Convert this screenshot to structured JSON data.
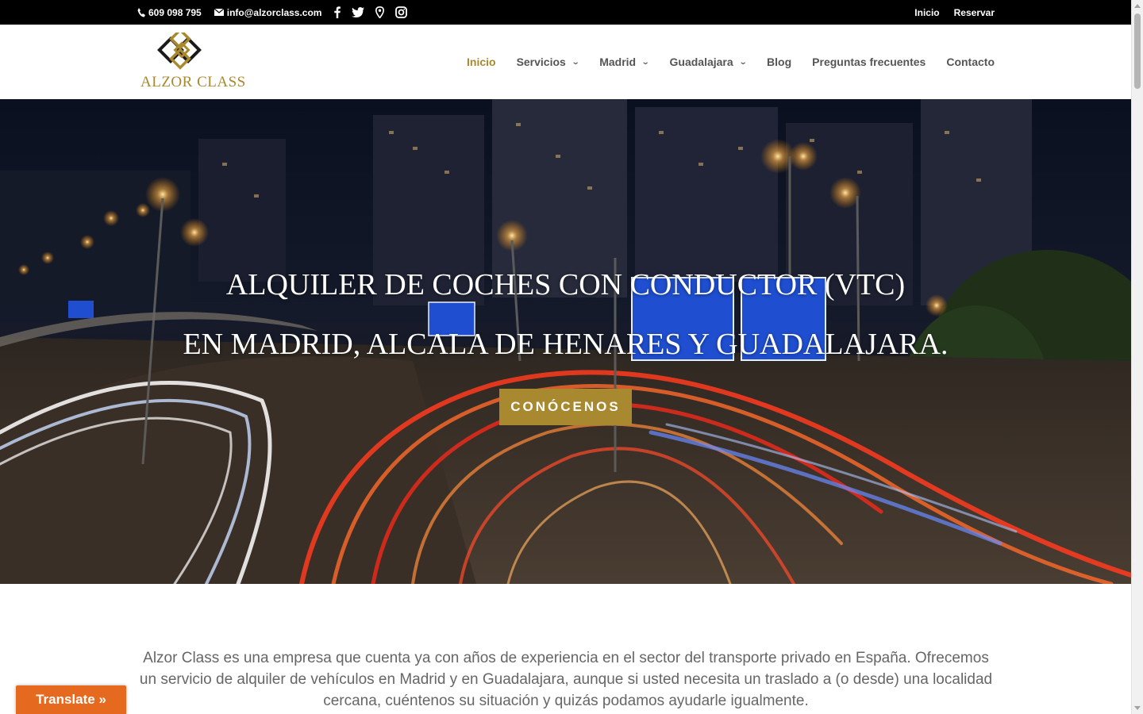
{
  "topbar": {
    "phone": "609 098 795",
    "email": "info@alzorclass.com",
    "social_icons": [
      "facebook-icon",
      "twitter-icon",
      "map-pin-icon",
      "instagram-icon"
    ],
    "links": [
      "Inicio",
      "Reservar"
    ]
  },
  "header": {
    "logo_text": "ALZOR CLASS",
    "nav": [
      {
        "label": "Inicio",
        "active": true,
        "dropdown": false
      },
      {
        "label": "Servicios",
        "active": false,
        "dropdown": true
      },
      {
        "label": "Madrid",
        "active": false,
        "dropdown": true
      },
      {
        "label": "Guadalajara",
        "active": false,
        "dropdown": true
      },
      {
        "label": "Blog",
        "active": false,
        "dropdown": false
      },
      {
        "label": "Preguntas frecuentes",
        "active": false,
        "dropdown": false
      },
      {
        "label": "Contacto",
        "active": false,
        "dropdown": false
      }
    ]
  },
  "hero": {
    "title_line1": "ALQUILER DE COCHES CON CONDUCTOR (VTC)",
    "title_line2": "EN MADRID, ALCALA DE HENARES Y GUADALAJARA.",
    "cta_label": "CONÓCENOS"
  },
  "intro": {
    "text": "Alzor Class es una empresa que cuenta ya con años de experiencia en el sector del transporte privado en España. Ofrecemos un servicio de alquiler de vehículos en Madrid y en Guadalajara, aunque si usted necesita un traslado a (o desde) una localidad cercana, cuéntenos su situación y quizás podamos ayudarle igualmente."
  },
  "translate": {
    "label": "Translate »"
  },
  "colors": {
    "accent": "#a8892f",
    "topbar": "#000000",
    "translate": "#e56a1f",
    "nav_text": "#555555",
    "body_text": "#666666"
  }
}
